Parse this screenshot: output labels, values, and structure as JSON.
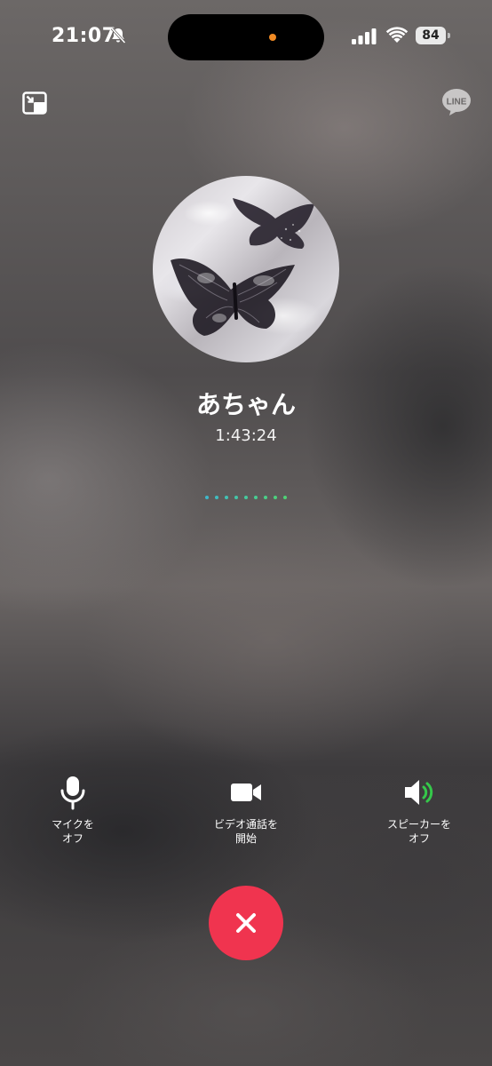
{
  "status_bar": {
    "time": "21:07",
    "battery": "84",
    "icons": [
      "bell-slash-icon",
      "signal-icon",
      "wifi-icon",
      "battery-icon"
    ],
    "island_indicator_color": "#f08a24"
  },
  "top_controls": {
    "minimize_icon": "picture-in-picture-icon",
    "app_badge": "LINE"
  },
  "caller": {
    "name": "あちゃん",
    "duration": "1:43:24"
  },
  "voice_indicator_colors": [
    "#3fb7c9",
    "#40bcbf",
    "#42c1b4",
    "#44c5a8",
    "#46c99d",
    "#48cd92",
    "#4acf88",
    "#4cd17e",
    "#4ed276"
  ],
  "controls": {
    "mic": {
      "line1": "マイクを",
      "line2": "オフ",
      "icon": "microphone-icon"
    },
    "video": {
      "line1": "ビデオ通話を",
      "line2": "開始",
      "icon": "video-camera-icon"
    },
    "speaker": {
      "line1": "スピーカーを",
      "line2": "オフ",
      "icon": "speaker-icon",
      "accent": "#35c84a"
    }
  },
  "end_call": {
    "icon": "close-icon",
    "color": "#f0344f"
  }
}
